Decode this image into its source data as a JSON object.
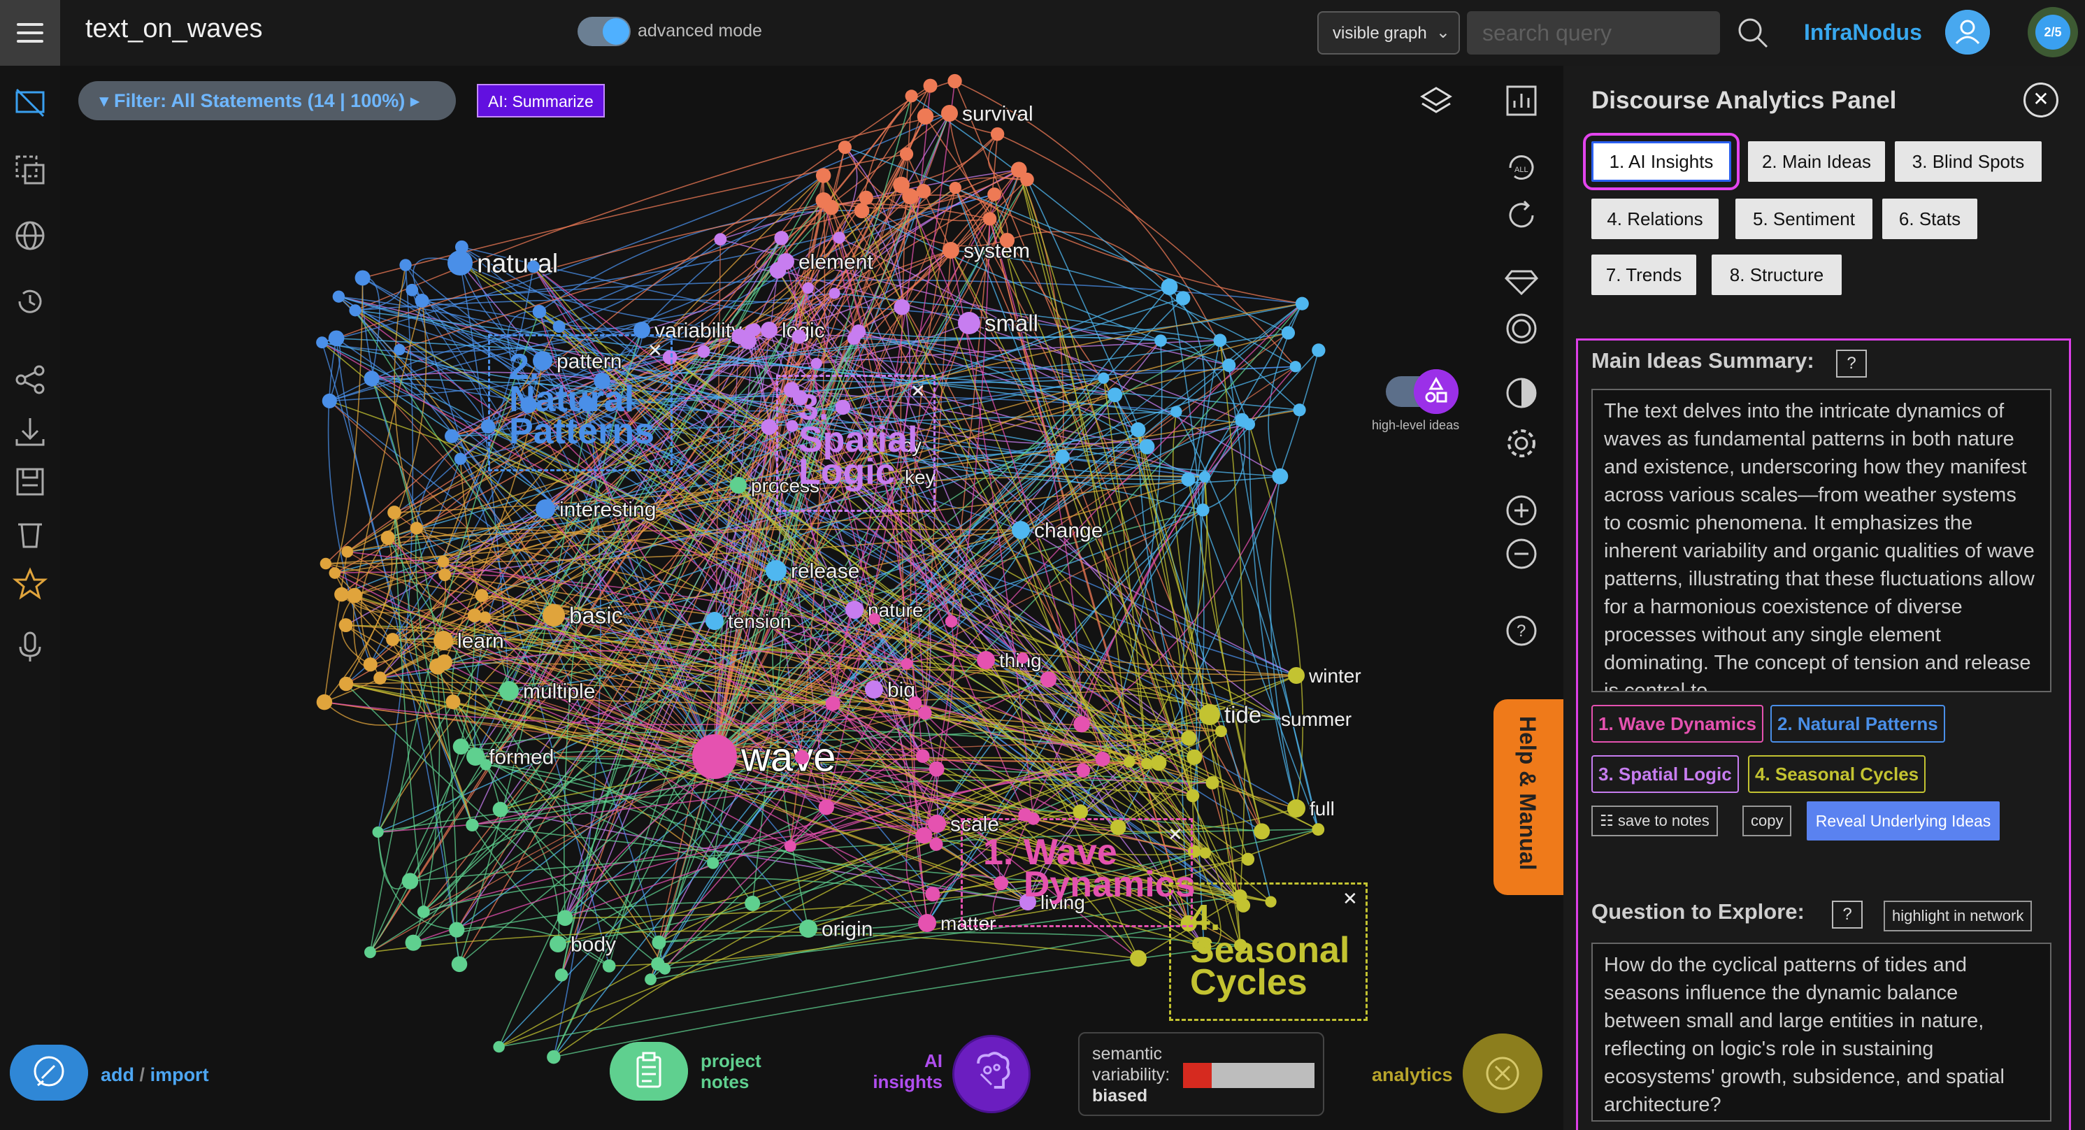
{
  "app": {
    "title": "text_on_waves",
    "advanced_mode_label": "advanced mode",
    "graph_select_value": "visible graph",
    "search_placeholder": "search query",
    "brand": "InfraNodus",
    "progress_badge": "2/5"
  },
  "graph": {
    "filter_label": "▾ Filter: All Statements (14 | 100%) ▸",
    "ai_summarize_label": "AI: Summarize",
    "high_level_ideas_label": "high-level ideas",
    "help_tab_label": "Help & Manual",
    "clusters": [
      {
        "number": "1.",
        "name": "Wave Dynamics",
        "color": "#e552b0"
      },
      {
        "number": "2.",
        "name": "Natural Patterns",
        "color": "#4a8fe8"
      },
      {
        "number": "3.",
        "name": "Spatial Logic",
        "color": "#c77df0"
      },
      {
        "number": "4.",
        "name": "Seasonal Cycles",
        "color": "#c3c331"
      }
    ],
    "nodes": [
      {
        "label": "wave",
        "color": "#e552b0"
      },
      {
        "label": "natural",
        "color": "#4a8fe8"
      },
      {
        "label": "pattern",
        "color": "#4a8fe8"
      },
      {
        "label": "variability",
        "color": "#4a8fe8"
      },
      {
        "label": "logic",
        "color": "#c77df0"
      },
      {
        "label": "element",
        "color": "#c77df0"
      },
      {
        "label": "survival",
        "color": "#ee7a55"
      },
      {
        "label": "system",
        "color": "#ee7a55"
      },
      {
        "label": "small",
        "color": "#c77df0"
      },
      {
        "label": "interesting",
        "color": "#4a8fe8"
      },
      {
        "label": "process",
        "color": "#5fd08f"
      },
      {
        "label": "cy",
        "color": "#c77df0"
      },
      {
        "label": "key",
        "color": "#c77df0"
      },
      {
        "label": "change",
        "color": "#4fb7f0"
      },
      {
        "label": "release",
        "color": "#4fb7f0"
      },
      {
        "label": "basic",
        "color": "#e0a43c"
      },
      {
        "label": "tension",
        "color": "#4fb7f0"
      },
      {
        "label": "nature",
        "color": "#c77df0"
      },
      {
        "label": "learn",
        "color": "#e0a43c"
      },
      {
        "label": "multiple",
        "color": "#5fd08f"
      },
      {
        "label": "thing",
        "color": "#e552b0"
      },
      {
        "label": "big",
        "color": "#c77df0"
      },
      {
        "label": "winter",
        "color": "#c3c331"
      },
      {
        "label": "tide",
        "color": "#c3c331"
      },
      {
        "label": "summer",
        "color": "#c3c331"
      },
      {
        "label": "formed",
        "color": "#5fd08f"
      },
      {
        "label": "scale",
        "color": "#e552b0"
      },
      {
        "label": "full",
        "color": "#c3c331"
      },
      {
        "label": "living",
        "color": "#c77df0"
      },
      {
        "label": "origin",
        "color": "#5fd08f"
      },
      {
        "label": "matter",
        "color": "#e552b0"
      },
      {
        "label": "body",
        "color": "#5fd08f"
      }
    ],
    "add_label": "add",
    "import_label": "import",
    "notes_label_1": "project",
    "notes_label_2": "notes",
    "ai_label_1": "AI",
    "ai_label_2": "insights",
    "semantic_label_1": "semantic",
    "semantic_label_2": "variability:",
    "semantic_value": "biased",
    "semantic_level": 0.22,
    "analytics_label": "analytics"
  },
  "panel": {
    "title": "Discourse Analytics Panel",
    "tabs": [
      {
        "label": "1. AI Insights",
        "active": true
      },
      {
        "label": "2. Main Ideas"
      },
      {
        "label": "3. Blind Spots"
      },
      {
        "label": "4. Relations"
      },
      {
        "label": "5. Sentiment"
      },
      {
        "label": "6. Stats"
      },
      {
        "label": "7. Trends"
      },
      {
        "label": "8. Structure"
      }
    ],
    "summary_title": "Main Ideas Summary:",
    "summary_help": "?",
    "summary_text": "The text delves into the intricate dynamics of waves as fundamental patterns in both nature and existence, underscoring how they manifest across various scales—from weather systems to cosmic phenomena. It emphasizes the inherent variability and organic qualities of wave patterns, illustrating that these fluctuations allow for a harmonious coexistence of diverse processes without any single element dominating. The concept of tension and release is central to",
    "topic_chips": [
      {
        "label": "1. Wave Dynamics",
        "color": "#e552b0"
      },
      {
        "label": "2. Natural Patterns",
        "color": "#4a8fe8"
      },
      {
        "label": "3. Spatial Logic",
        "color": "#c77df0"
      },
      {
        "label": "4. Seasonal Cycles",
        "color": "#c3c331"
      }
    ],
    "save_to_notes": "☷ save to notes",
    "copy": "copy",
    "reveal": "Reveal Underlying Ideas",
    "question_title": "Question to Explore:",
    "question_help": "?",
    "highlight_label": "highlight in network",
    "question_text": "How do the cyclical patterns of tides and seasons influence the dynamic balance between small and large entities in nature, reflecting on logic's role in sustaining ecosystems' growth, subsidence, and spatial architecture?"
  }
}
